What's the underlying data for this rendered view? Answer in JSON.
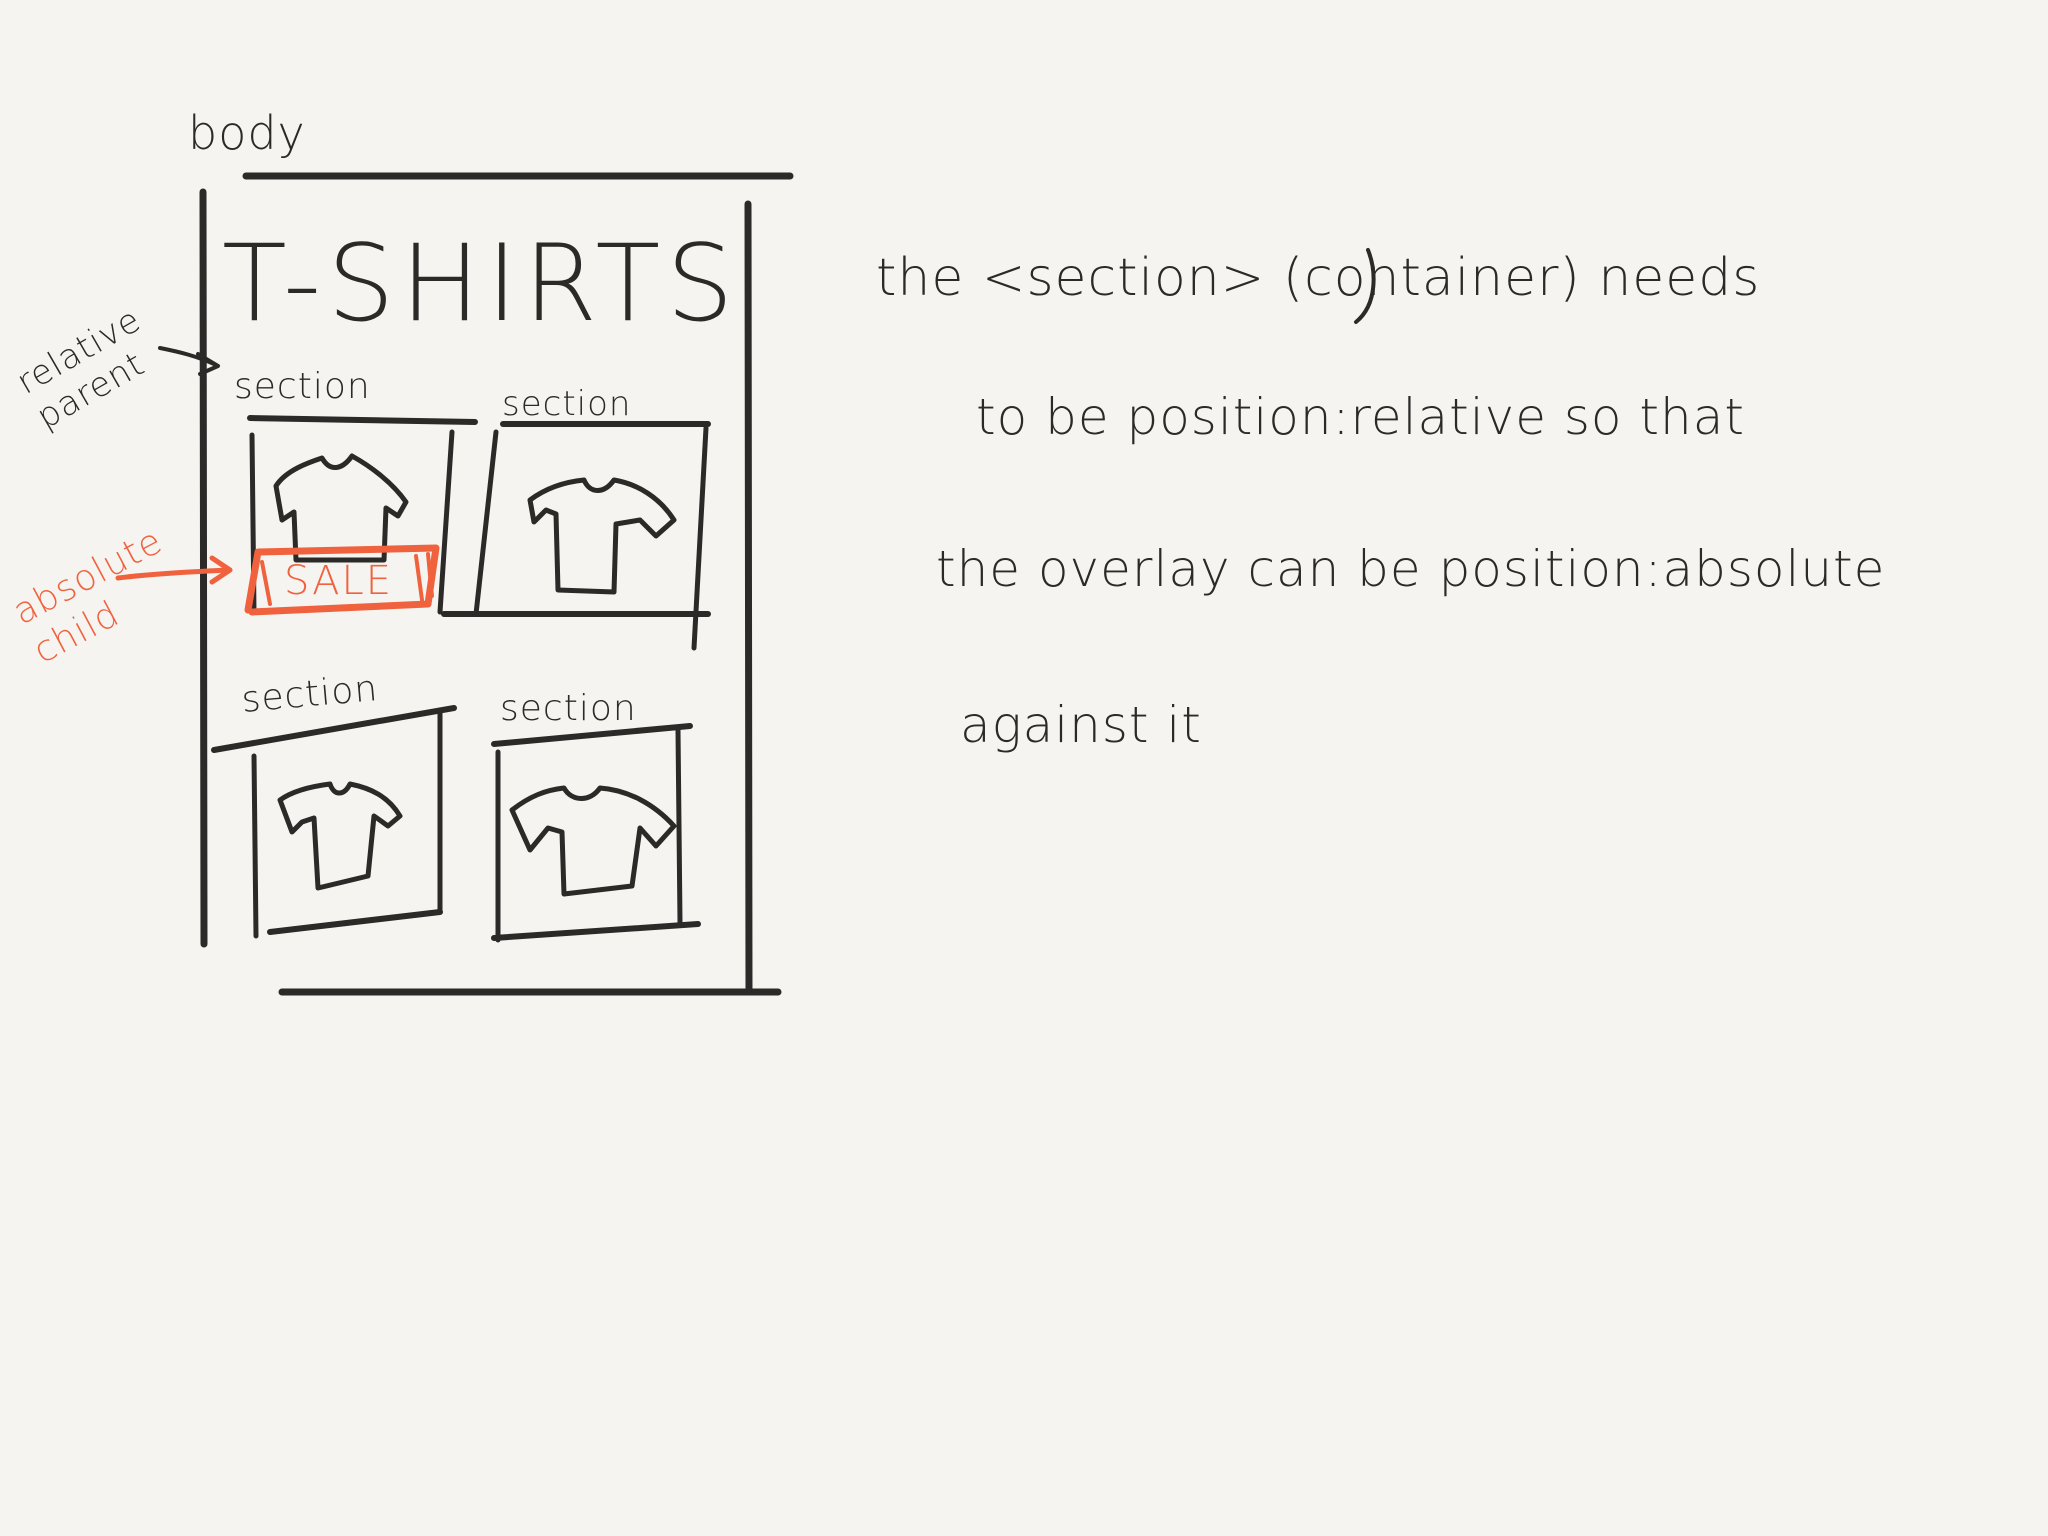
{
  "labels": {
    "body": "body",
    "heading": "T-SHIRTS",
    "section_label": "section",
    "sale": "SALE",
    "relative_parent": "relative parent",
    "absolute_child": "absolute child"
  },
  "note": {
    "line1": "the <section> (container) needs",
    "line2": "to be position:relative so that",
    "line3": "the overlay can be position:absolute",
    "line4": "against it"
  },
  "colors": {
    "ink": "#2b2a28",
    "accent": "#f0623e",
    "paper": "#f5f4f0"
  }
}
